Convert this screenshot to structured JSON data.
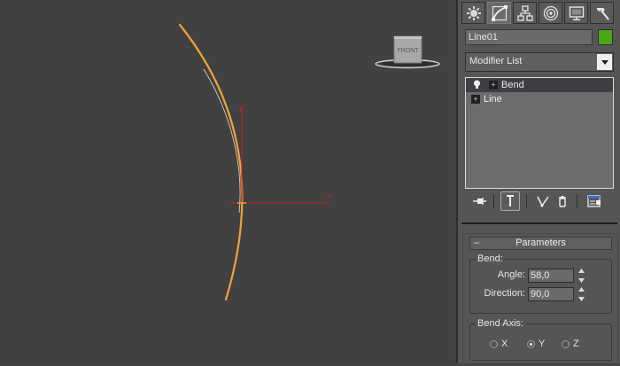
{
  "viewport": {
    "cube_label": "FRONT",
    "axis_x": "x",
    "axis_y": "y"
  },
  "command_panel": {
    "tabs": [
      {
        "name": "create-tab",
        "icon": "sun-gear-icon"
      },
      {
        "name": "modify-tab",
        "icon": "modify-curve-icon"
      },
      {
        "name": "hierarchy-tab",
        "icon": "hierarchy-icon"
      },
      {
        "name": "motion-tab",
        "icon": "motion-icon"
      },
      {
        "name": "display-tab",
        "icon": "monitor-icon"
      },
      {
        "name": "utilities-tab",
        "icon": "hammer-icon"
      }
    ],
    "object_name": "Line01",
    "object_color": "#4ca61a",
    "modifier_list_label": "Modifier List",
    "stack_items": [
      "Bend",
      "Line"
    ],
    "stack_tools": [
      {
        "name": "pin-stack-icon"
      },
      {
        "name": "show-end-result-icon"
      },
      {
        "name": "make-unique-icon"
      },
      {
        "name": "remove-modifier-icon"
      },
      {
        "name": "configure-modifier-sets-icon"
      }
    ]
  },
  "parameters": {
    "rollout_title": "Parameters",
    "rollout_toggle": "–",
    "bend_group": "Bend:",
    "angle_label": "Angle:",
    "angle_value": "58,0",
    "direction_label": "Direction:",
    "direction_value": "90,0",
    "bend_axis_group": "Bend Axis:",
    "axes": [
      {
        "label": "X",
        "selected": false
      },
      {
        "label": "Y",
        "selected": true
      },
      {
        "label": "Z",
        "selected": false
      }
    ]
  },
  "colors": {
    "viewport_bg": "#414141",
    "curve": "#f2a13a",
    "axis": "#c21f1f",
    "panel_bg": "#555555"
  }
}
